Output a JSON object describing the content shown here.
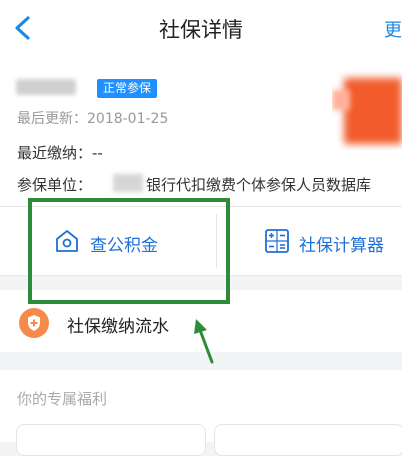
{
  "header": {
    "title": "社保详情",
    "right_action": "更",
    "back_icon": "chevron-left-icon"
  },
  "info": {
    "badge": "正常参保",
    "last_updated": "最后更新：2018-01-25",
    "recent_payment": "最近缴纳：--",
    "unit_label": "参保单位：",
    "unit_value": "银行代扣缴费个体参保人员数据库"
  },
  "actions": [
    {
      "label": "查公积金",
      "icon": "house-icon"
    },
    {
      "label": "社保计算器",
      "icon": "calculator-icon"
    }
  ],
  "list": {
    "label": "社保缴纳流水",
    "icon": "shield-icon"
  },
  "benefits": {
    "title": "你的专属福利"
  },
  "colors": {
    "accent": "#1e88e5",
    "badge": "#1e90ff",
    "annotation": "#2e8b3a",
    "shield": "#f58a4b"
  }
}
